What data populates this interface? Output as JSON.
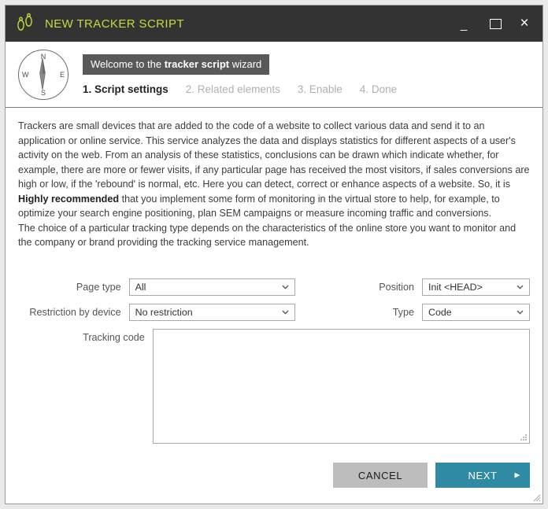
{
  "window": {
    "title": "NEW TRACKER SCRIPT",
    "icon": "footprints-icon",
    "controls": {
      "minimize": "_",
      "maximize": "",
      "close": "×"
    }
  },
  "wizard": {
    "compass_icon": "compass-icon",
    "compass_labels": {
      "north": "N",
      "east": "E",
      "south": "S",
      "west": "W"
    },
    "welcome_prefix": "Welcome to the ",
    "welcome_bold": "tracker script",
    "welcome_suffix": " wizard",
    "steps": [
      {
        "label": "1. Script settings",
        "active": true
      },
      {
        "label": "2. Related elements",
        "active": false
      },
      {
        "label": "3. Enable",
        "active": false
      },
      {
        "label": "4. Done",
        "active": false
      }
    ]
  },
  "intro": {
    "para1_a": "Trackers are small devices that are added to the code of a website to collect various data and send it to an application or online service. This service analyzes the data and displays statistics for different aspects of a user's activity on the web. From an analysis of these statistics, conclusions can be drawn which indicate whether, for example, there are more or fewer visits, if any particular page has received the most visitors, if sales conversions are high or low, if the 'rebound' is normal, etc. Here you can detect, correct or enhance aspects of a website. So, it is ",
    "para1_bold": "Highly recommended",
    "para1_b": " that you implement some form of monitoring in the virtual store to help, for example, to optimize your search engine positioning, plan SEM campaigns or measure incoming traffic and conversions.",
    "para2": "The choice of a particular tracking type depends on the characteristics of the online store you want to monitor and the company or brand providing the tracking service management."
  },
  "form": {
    "page_type": {
      "label": "Page type",
      "value": "All"
    },
    "position": {
      "label": "Position",
      "value": "Init <HEAD>"
    },
    "restriction": {
      "label": "Restriction by device",
      "value": "No restriction"
    },
    "type": {
      "label": "Type",
      "value": "Code"
    },
    "tracking_code": {
      "label": "Tracking code",
      "value": "",
      "placeholder": ""
    }
  },
  "footer": {
    "cancel_label": "CANCEL",
    "next_label": "NEXT",
    "next_arrow": "▶"
  },
  "colors": {
    "titlebar_bg": "#333333",
    "title_text": "#c9d93a",
    "badge_bg": "#595959",
    "accent_teal": "#2e8ba3",
    "cancel_gray": "#bdbdbd",
    "step_inactive": "#b0b0b0"
  }
}
